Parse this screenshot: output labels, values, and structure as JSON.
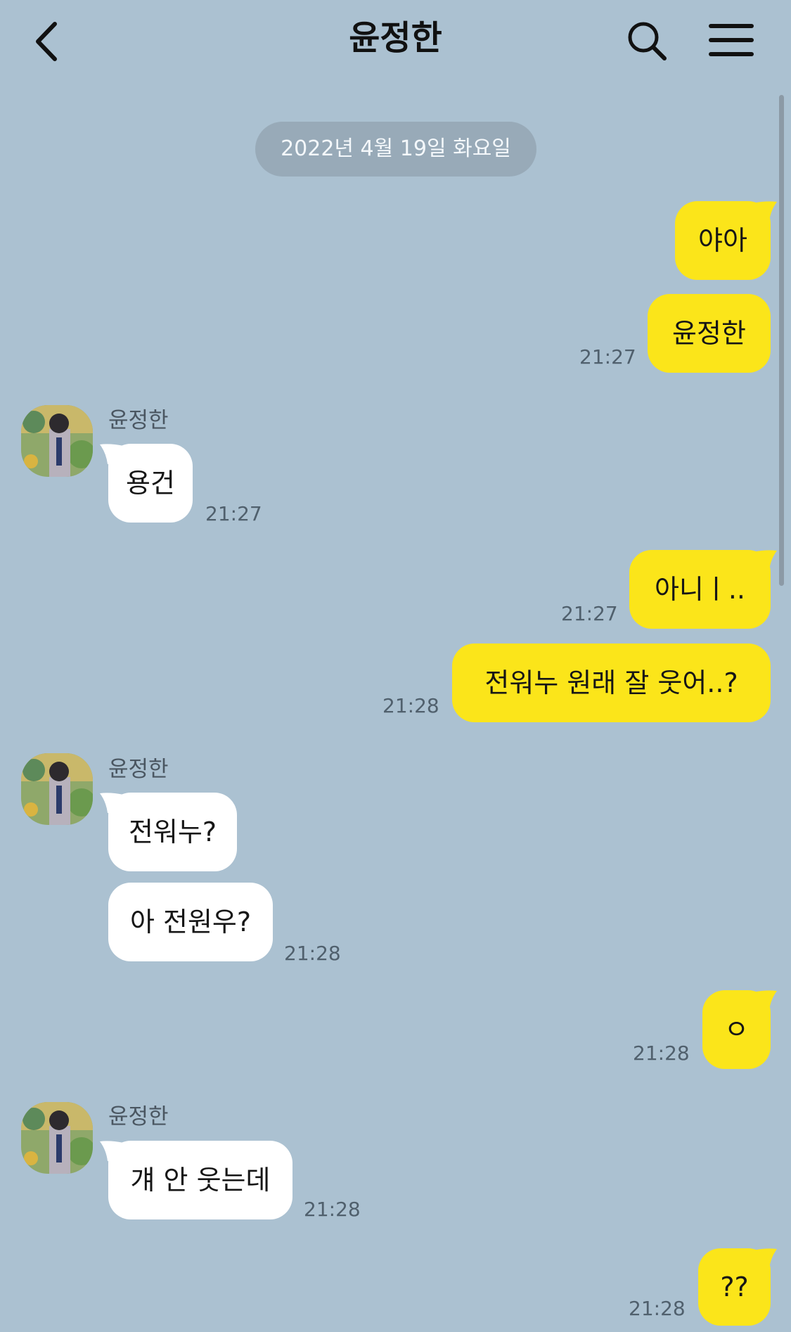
{
  "header": {
    "title": "윤정한",
    "back_icon": "chevron-left-icon",
    "search_icon": "search-icon",
    "menu_icon": "menu-icon"
  },
  "date_divider": "2022년 4월 19일 화요일",
  "colors": {
    "background": "#abc1d1",
    "my_bubble": "#fbe51a",
    "their_bubble": "#ffffff",
    "date_pill": "#98aab8",
    "time_text": "#50606d"
  },
  "messages": [
    {
      "from": "me",
      "text": "야아",
      "time": ""
    },
    {
      "from": "me",
      "text": "윤정한",
      "time": "21:27"
    },
    {
      "from": "them",
      "sender": "윤정한",
      "text": "용건",
      "time": "21:27"
    },
    {
      "from": "me",
      "text": "아니ㅣ..",
      "time": "21:27"
    },
    {
      "from": "me",
      "text": "전워누 원래 잘 웃어..?",
      "time": "21:28"
    },
    {
      "from": "them",
      "sender": "윤정한",
      "text": "전워누?",
      "time": ""
    },
    {
      "from": "them",
      "text": "아 전원우?",
      "time": "21:28"
    },
    {
      "from": "me",
      "text": "ㅇ",
      "time": "21:28"
    },
    {
      "from": "them",
      "sender": "윤정한",
      "text": "걔 안 웃는데",
      "time": "21:28"
    },
    {
      "from": "me",
      "text": "??",
      "time": "21:28"
    }
  ]
}
